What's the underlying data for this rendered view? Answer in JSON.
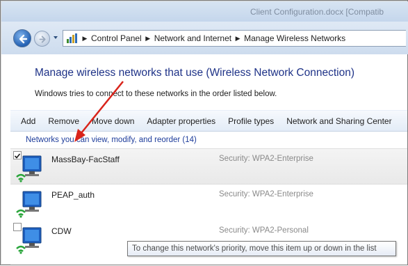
{
  "window": {
    "title": "Client Configuration.docx [Compatib"
  },
  "navigation": {
    "back_icon": "back-arrow-icon",
    "forward_icon": "forward-arrow-icon",
    "breadcrumb": [
      "Control Panel",
      "Network and Internet",
      "Manage Wireless Networks"
    ]
  },
  "main": {
    "heading": "Manage wireless networks that use (Wireless Network Connection)",
    "subtext": "Windows tries to connect to these networks in the order listed below."
  },
  "toolbar": {
    "add": "Add",
    "remove": "Remove",
    "move_down": "Move down",
    "adapter_properties": "Adapter properties",
    "profile_types": "Profile types",
    "network_sharing": "Network and Sharing Center"
  },
  "list": {
    "group_header": "Networks you can view, modify, and reorder (14)",
    "networks": [
      {
        "name": "MassBay-FacStaff",
        "security": "Security:  WPA2-Enterprise",
        "checked": true
      },
      {
        "name": "PEAP_auth",
        "security": "Security:  WPA2-Enterprise",
        "checked": false
      },
      {
        "name": "CDW",
        "security": "Security:  WPA2-Personal",
        "checked": false
      }
    ]
  },
  "tooltip": "To change this network's priority, move this item up or down in the list",
  "colors": {
    "heading": "#1e3287",
    "group_header": "#1e3d9b",
    "annotation_arrow": "#d9241b"
  }
}
